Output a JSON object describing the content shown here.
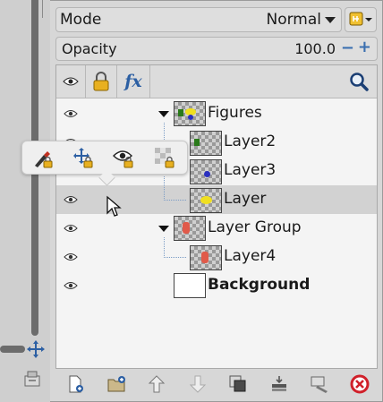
{
  "mode": {
    "label": "Mode",
    "value": "Normal"
  },
  "opacity": {
    "label": "Opacity",
    "value": "100.0",
    "minus": "−",
    "plus": "+"
  },
  "header": {
    "eye_icon": "eye-icon",
    "lock_icon": "lock-icon",
    "fx_icon": "fx-icon",
    "fx_label": "fx",
    "search_icon": "search-icon"
  },
  "layers": [
    {
      "name": "Figures",
      "type": "group",
      "expanded": true,
      "bold": false,
      "selected": false
    },
    {
      "name": "Layer2",
      "type": "layer",
      "bold": false,
      "selected": false
    },
    {
      "name": "Layer3",
      "type": "layer",
      "bold": false,
      "selected": false
    },
    {
      "name": "Layer",
      "type": "layer",
      "bold": false,
      "selected": true
    },
    {
      "name": "Layer Group",
      "type": "group",
      "expanded": true,
      "bold": false,
      "selected": false
    },
    {
      "name": "Layer4",
      "type": "layer",
      "bold": false,
      "selected": false
    },
    {
      "name": "Background",
      "type": "layer",
      "bold": true,
      "selected": false
    }
  ],
  "lock_popover": {
    "items": [
      "lock-pixels-icon",
      "lock-position-icon",
      "lock-visibility-icon",
      "lock-alpha-icon"
    ]
  },
  "toolbar": {
    "items": [
      "new-layer-icon",
      "new-layer-group-icon",
      "raise-layer-icon",
      "lower-layer-icon",
      "duplicate-layer-icon",
      "merge-layer-icon",
      "anchor-layer-icon",
      "delete-layer-icon"
    ]
  },
  "colors": {
    "selected_row": "#d2d2d2",
    "accent_blue": "#3a6fb0",
    "delete_red": "#d0202a",
    "lock_yellow": "#e8b020"
  }
}
